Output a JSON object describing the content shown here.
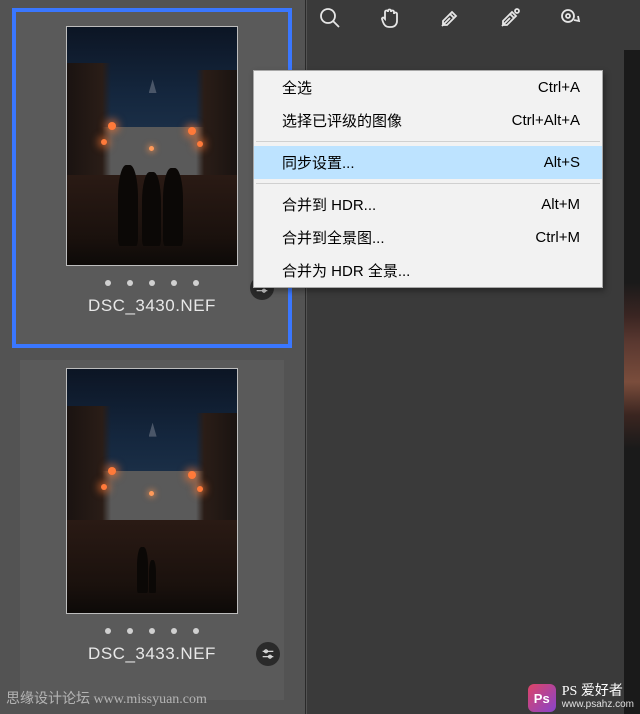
{
  "toolbar": {
    "zoom_icon": "zoom-tool",
    "hand_icon": "hand-tool",
    "white_balance_icon": "white-balance-tool",
    "color_sampler_icon": "color-sampler-tool",
    "targeted_icon": "targeted-adjustment-tool"
  },
  "filmstrip": {
    "items": [
      {
        "filename": "DSC_3430.NEF",
        "selected": true,
        "rating_dots": 5,
        "has_adjustments": true
      },
      {
        "filename": "DSC_3433.NEF",
        "selected": false,
        "rating_dots": 5,
        "has_adjustments": true
      }
    ]
  },
  "context_menu": {
    "items": [
      {
        "label": "全选",
        "shortcut": "Ctrl+A",
        "highlight": false
      },
      {
        "label": "选择已评级的图像",
        "shortcut": "Ctrl+Alt+A",
        "highlight": false
      },
      {
        "separator": true
      },
      {
        "label": "同步设置...",
        "shortcut": "Alt+S",
        "highlight": true
      },
      {
        "separator": true
      },
      {
        "label": "合并到 HDR...",
        "shortcut": "Alt+M",
        "highlight": false
      },
      {
        "label": "合并到全景图...",
        "shortcut": "Ctrl+M",
        "highlight": false
      },
      {
        "label": "合并为 HDR 全景...",
        "shortcut": "",
        "highlight": false
      }
    ]
  },
  "watermark": {
    "left_text": "思缘设计论坛   www.missyuan.com",
    "right_cn": "爱好者",
    "right_prefix": "PS",
    "right_url": "www.psahz.com"
  }
}
